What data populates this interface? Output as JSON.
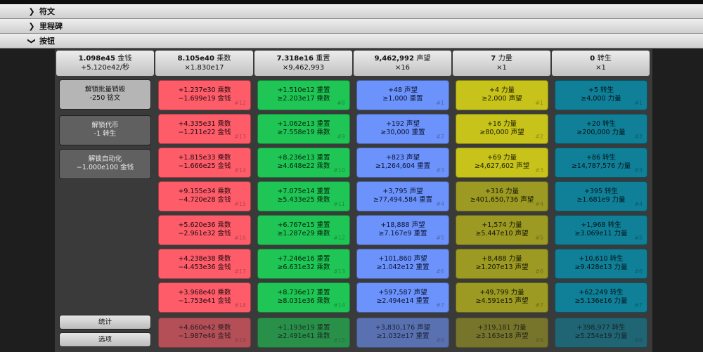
{
  "accordions": [
    {
      "label": "符文"
    },
    {
      "label": "里程碑"
    },
    {
      "label": "按钮"
    }
  ],
  "resources": [
    {
      "amount": "1.098e45",
      "unit": "金钱",
      "rate": "+5.120e42/秒"
    },
    {
      "amount": "8.105e40",
      "unit": "乘数",
      "rate": "×1.830e17"
    },
    {
      "amount": "7.318e16",
      "unit": "重置",
      "rate": "×9,462,993"
    },
    {
      "amount": "9,462,992",
      "unit": "声望",
      "rate": "×16"
    },
    {
      "amount": "7",
      "unit": "力量",
      "rate": "×1"
    },
    {
      "amount": "0",
      "unit": "转生",
      "rate": "×1"
    }
  ],
  "left_buttons": [
    {
      "line1": "解锁批量销毁",
      "line2": "-250 铭文"
    },
    {
      "line1": "解锁代币",
      "line2": "-1 转生"
    },
    {
      "line1": "解锁自动化",
      "line2": "−1.000e100 金钱"
    }
  ],
  "bottom_buttons": [
    {
      "label": "统计"
    },
    {
      "label": "选项"
    }
  ],
  "columns": [
    {
      "cells": [
        {
          "gain": "+1.237e30 乘数",
          "cost": "−1.699e19 金钱",
          "num": "#12"
        },
        {
          "gain": "+4.335e31 乘数",
          "cost": "−1.211e22 金钱",
          "num": "#13"
        },
        {
          "gain": "+1.815e33 乘数",
          "cost": "−1.666e25 金钱",
          "num": "#14"
        },
        {
          "gain": "+9.155e34 乘数",
          "cost": "−4.720e28 金钱",
          "num": "#15"
        },
        {
          "gain": "+5.620e36 乘数",
          "cost": "−2.961e32 金钱",
          "num": "#16"
        },
        {
          "gain": "+4.238e38 乘数",
          "cost": "−4.453e36 金钱",
          "num": "#17"
        },
        {
          "gain": "+3.968e40 乘数",
          "cost": "−1.753e41 金钱",
          "num": "#18"
        },
        {
          "gain": "+4.660e42 乘数",
          "cost": "−1.987e46 金钱",
          "num": "#19"
        }
      ]
    },
    {
      "cells": [
        {
          "gain": "+1.510e12 重置",
          "cost": "≥2.203e17 乘数",
          "num": "#8"
        },
        {
          "gain": "+1.062e13 重置",
          "cost": "≥7.558e19 乘数",
          "num": "#9"
        },
        {
          "gain": "+8.236e13 重置",
          "cost": "≥4.648e22 乘数",
          "num": "#10"
        },
        {
          "gain": "+7.075e14 重置",
          "cost": "≥5.433e25 乘数",
          "num": "#11"
        },
        {
          "gain": "+6.767e15 重置",
          "cost": "≥1.287e29 乘数",
          "num": "#12"
        },
        {
          "gain": "+7.246e16 重置",
          "cost": "≥6.631e32 乘数",
          "num": "#13"
        },
        {
          "gain": "+8.736e17 重置",
          "cost": "≥8.031e36 乘数",
          "num": "#14"
        },
        {
          "gain": "+1.193e19 重置",
          "cost": "≥2.491e41 乘数",
          "num": "#15"
        }
      ]
    },
    {
      "cells": [
        {
          "gain": "+48 声望",
          "cost": "≥1,000 重置",
          "num": "#1"
        },
        {
          "gain": "+192 声望",
          "cost": "≥30,000 重置",
          "num": "#2"
        },
        {
          "gain": "+823 声望",
          "cost": "≥1,264,604 重置",
          "num": "#3"
        },
        {
          "gain": "+3,795 声望",
          "cost": "≥77,494,584 重置",
          "num": "#4"
        },
        {
          "gain": "+18,888 声望",
          "cost": "≥7.167e9 重置",
          "num": "#5"
        },
        {
          "gain": "+101,860 声望",
          "cost": "≥1.042e12 重置",
          "num": "#6"
        },
        {
          "gain": "+597,587 声望",
          "cost": "≥2.494e14 重置",
          "num": "#7"
        },
        {
          "gain": "+3,830,176 声望",
          "cost": "≥1.032e17 重置",
          "num": "#8"
        }
      ]
    },
    {
      "cells": [
        {
          "gain": "+4 力量",
          "cost": "≥2,000 声望",
          "num": "#1"
        },
        {
          "gain": "+16 力量",
          "cost": "≥80,000 声望",
          "num": "#2"
        },
        {
          "gain": "+69 力量",
          "cost": "≥4,627,602 声望",
          "num": "#3"
        },
        {
          "gain": "+316 力量",
          "cost": "≥401,650,736 声望",
          "num": "#4"
        },
        {
          "gain": "+1,574 力量",
          "cost": "≥5.447e10 声望",
          "num": "#5"
        },
        {
          "gain": "+8,488 力量",
          "cost": "≥1.207e13 声望",
          "num": "#6"
        },
        {
          "gain": "+49,799 力量",
          "cost": "≥4.591e15 声望",
          "num": "#7"
        },
        {
          "gain": "+319,181 力量",
          "cost": "≥3.163e18 声望",
          "num": "#8"
        }
      ]
    },
    {
      "cells": [
        {
          "gain": "+5 转生",
          "cost": "≥4,000 力量",
          "num": "#1"
        },
        {
          "gain": "+20 转生",
          "cost": "≥200,000 力量",
          "num": "#2"
        },
        {
          "gain": "+86 转生",
          "cost": "≥14,787,576 力量",
          "num": "#3"
        },
        {
          "gain": "+395 转生",
          "cost": "≥1.681e9 力量",
          "num": "#4"
        },
        {
          "gain": "+1,968 转生",
          "cost": "≥3.069e11 力量",
          "num": "#5"
        },
        {
          "gain": "+10,610 转生",
          "cost": "≥9.428e13 力量",
          "num": "#6"
        },
        {
          "gain": "+62,249 转生",
          "cost": "≥5.136e16 力量",
          "num": "#7"
        },
        {
          "gain": "+398,977 转生",
          "cost": "≥5.254e19 力量",
          "num": "#8"
        }
      ]
    }
  ],
  "colors": {
    "multiplier": "#ff5c6a",
    "reset": "#1fc655",
    "prestige": "#6c92fb",
    "power": "#c7c31a",
    "rebirth": "#0f8098"
  }
}
